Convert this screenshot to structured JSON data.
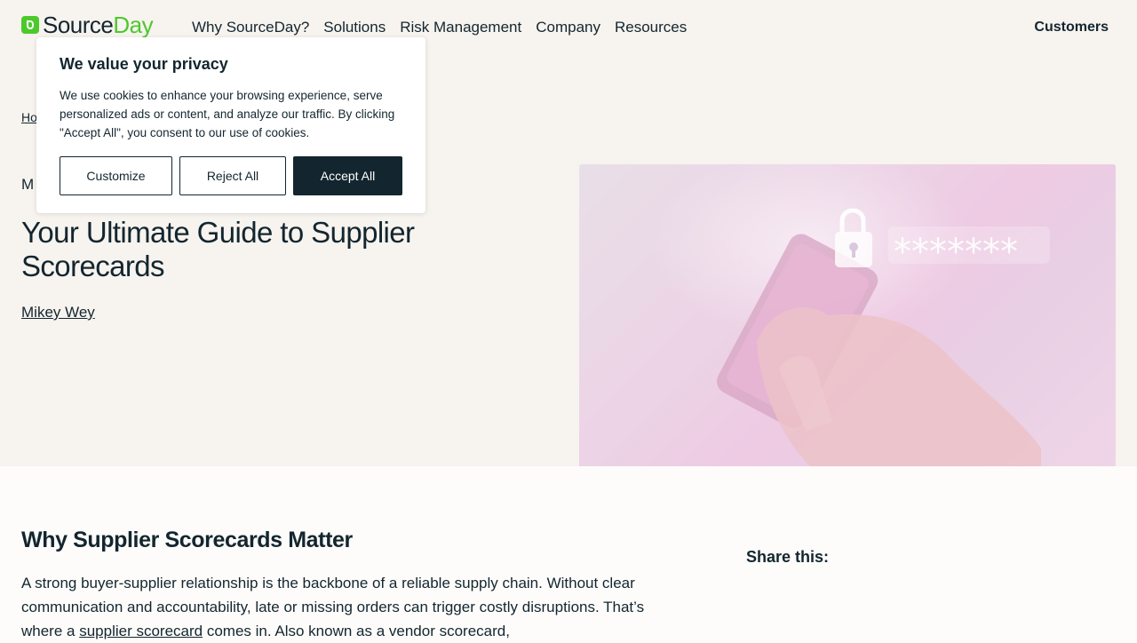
{
  "header": {
    "logo_source": "Source",
    "logo_day": "Day",
    "nav": [
      "Why SourceDay?",
      "Solutions",
      "Risk Management",
      "Company",
      "Resources"
    ],
    "customers": "Customers"
  },
  "hero": {
    "breadcrumb_partial": "Ho",
    "category_partial": "M",
    "title": "Your Ultimate Guide to Supplier Scorecards",
    "author": "Mikey Wey",
    "image_password_mask": "*******"
  },
  "cookie": {
    "title": "We value your privacy",
    "text": "We use cookies to enhance your browsing experience, serve personalized ads or content, and analyze our traffic. By clicking \"Accept All\", you consent to our use of cookies.",
    "customize": "Customize",
    "reject": "Reject All",
    "accept": "Accept All"
  },
  "article": {
    "heading": "Why Supplier Scorecards Matter",
    "para_before_link": "A strong buyer-supplier relationship is the backbone of a reliable supply chain. Without clear communication and accountability, late or missing orders can trigger costly disruptions. That’s where a ",
    "para_link": "supplier scorecard",
    "para_after_link": " comes in. Also known as a vendor scorecard,",
    "share": "Share this:"
  },
  "colors": {
    "brand_green": "#4cc92b",
    "navy": "#13262f",
    "hero_bg": "#f7f3ef"
  }
}
